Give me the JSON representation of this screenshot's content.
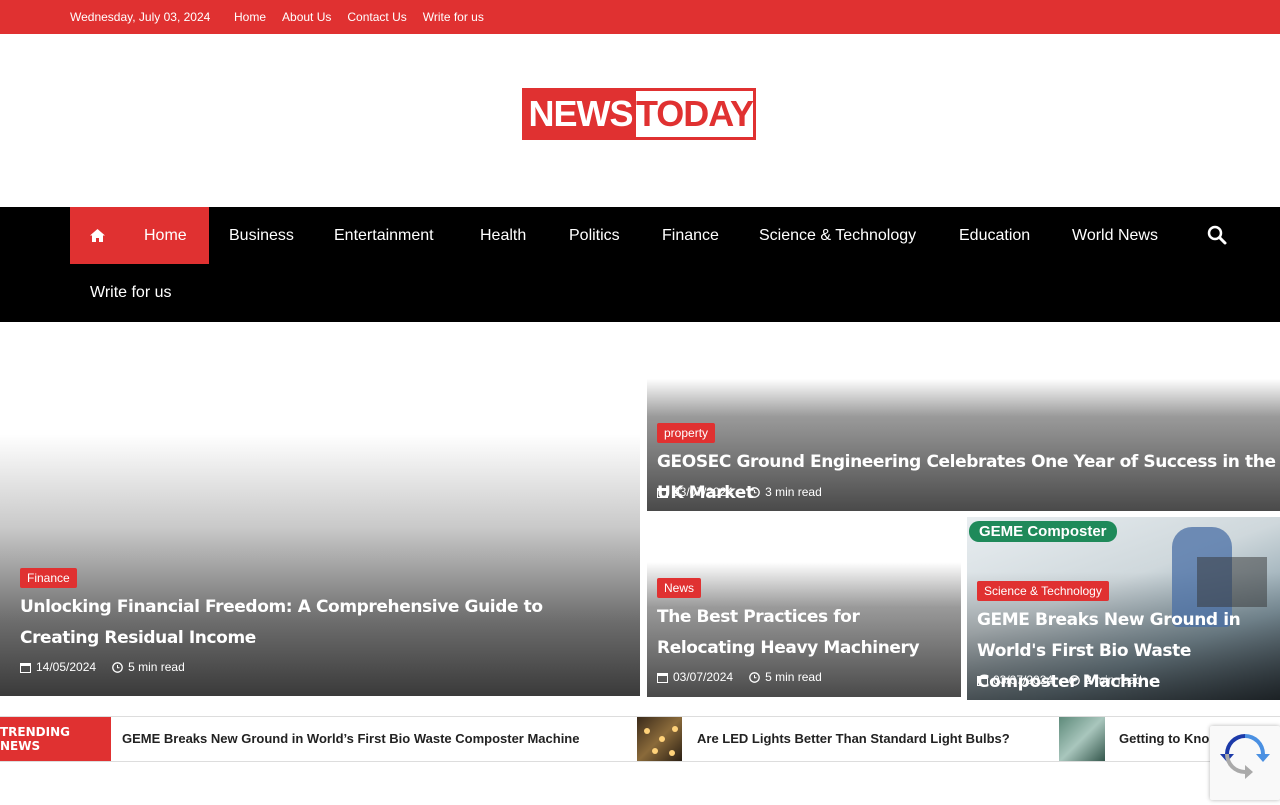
{
  "topbar": {
    "date": "Wednesday, July 03, 2024",
    "links": [
      "Home",
      "About Us",
      "Contact Us",
      "Write for us"
    ]
  },
  "logo": {
    "part1": "NEWS",
    "part2": "TODAY"
  },
  "nav": {
    "items": [
      "Home",
      "Business",
      "Entertainment",
      "Health",
      "Politics",
      "Finance",
      "Science & Technology",
      "Education",
      "World News",
      "Write for us"
    ]
  },
  "featured": {
    "main": {
      "category": "Finance",
      "title": "Unlocking Financial Freedom: A Comprehensive Guide to Creating Residual Income",
      "date": "14/05/2024",
      "read": "5 min read"
    },
    "top_right": {
      "category": "property",
      "title": "GEOSEC Ground Engineering Celebrates One Year of Success in the UK Market",
      "date": "03/07/2024",
      "read": "3 min read"
    },
    "bottom_mid": {
      "category": "News",
      "title": "The Best Practices for Relocating Heavy Machinery",
      "date": "03/07/2024",
      "read": "5 min read"
    },
    "bottom_right": {
      "category": "Science & Technology",
      "title": "GEME Breaks New Ground in World's First Bio Waste Composter Machine",
      "date": "03/07/2024",
      "read": "2 min read",
      "image_text": "GEME Composter"
    }
  },
  "trending": {
    "label": "TRENDING NEWS",
    "items": [
      "GEME Breaks New Ground in World’s First Bio Waste Composter Machine",
      "Are LED Lights Better Than Standard Light Bulbs?",
      "Getting to Kno"
    ]
  },
  "colors": {
    "accent": "#e03131",
    "nav_bg": "#000000"
  }
}
